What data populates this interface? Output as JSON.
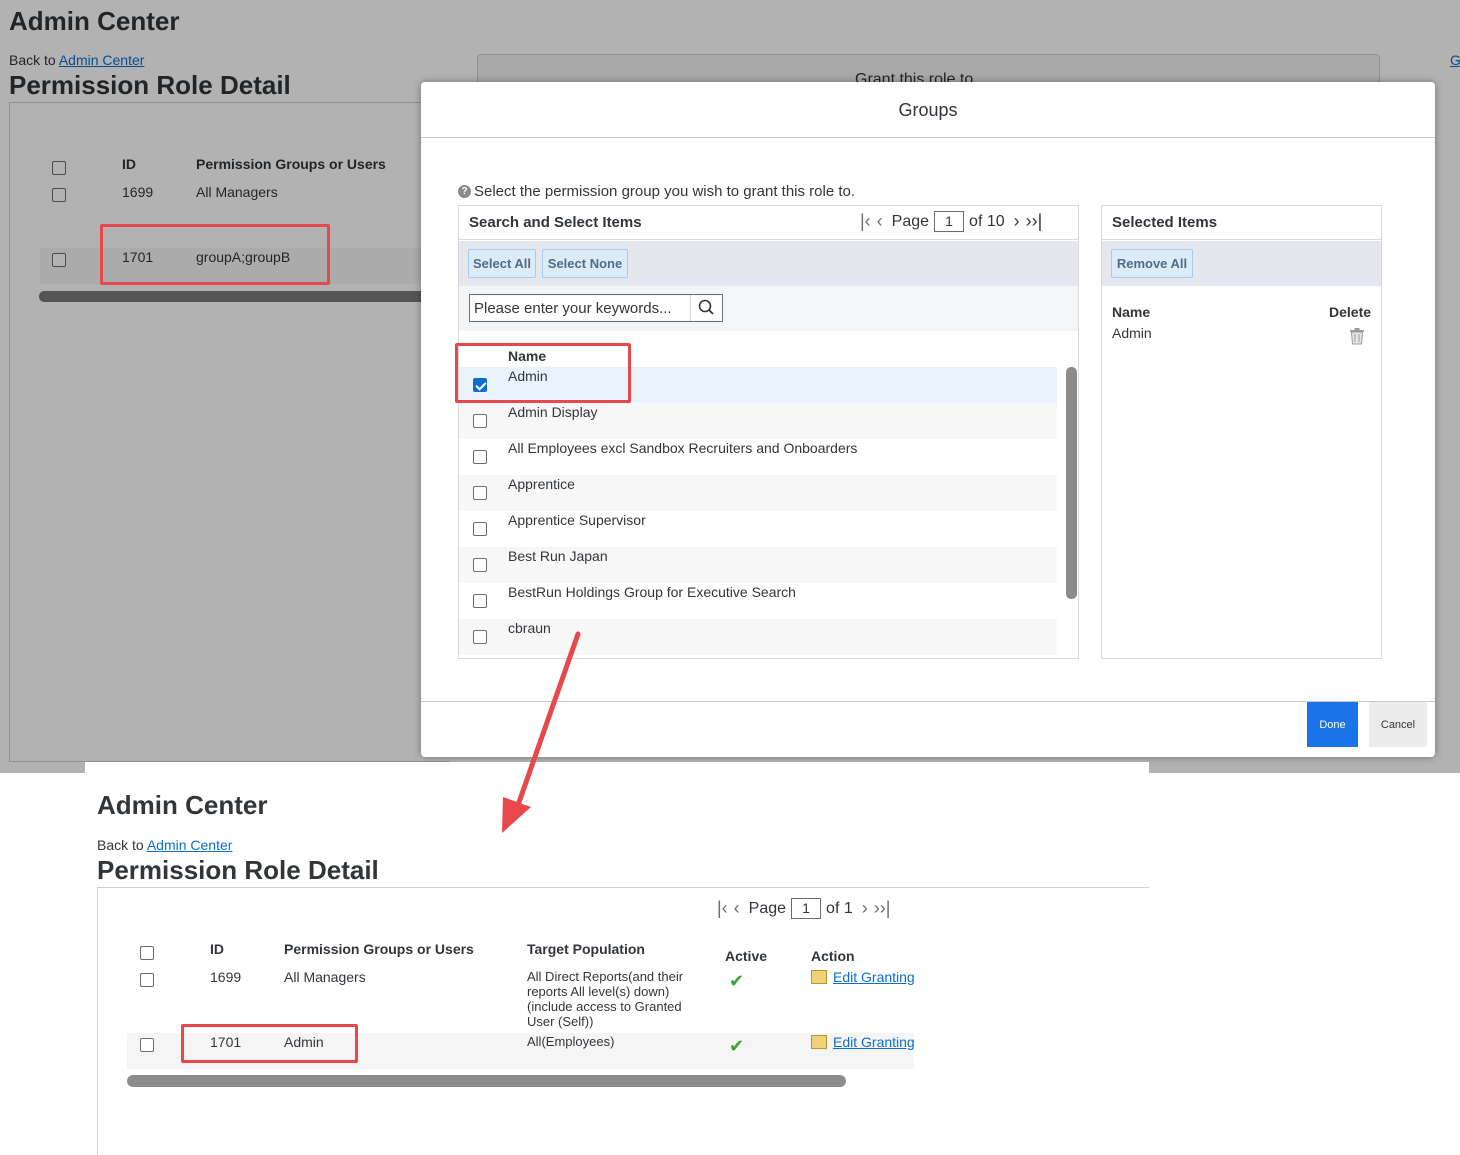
{
  "top": {
    "app_title": "Admin Center",
    "back_prefix": "Back to",
    "back_link": "Admin Center",
    "page_title": "Permission Role Detail",
    "grant_header_partial": "Grant this role to",
    "right_edge_link": "G",
    "table": {
      "headers": {
        "id": "ID",
        "groups": "Permission Groups or Users"
      },
      "rows": [
        {
          "id": "1699",
          "groups": "All Managers"
        },
        {
          "id": "1701",
          "groups": "groupA;groupB"
        }
      ]
    }
  },
  "dialog": {
    "title": "Groups",
    "instruction": "Select the permission group you wish to grant this role to.",
    "search_panel": {
      "title": "Search and Select Items",
      "pager": {
        "label": "Page",
        "current": "1",
        "of": "of 10"
      },
      "select_all": "Select All",
      "select_none": "Select None",
      "search_placeholder": "Please enter your keywords...",
      "column_name": "Name",
      "items": [
        {
          "name": "Admin",
          "checked": true
        },
        {
          "name": "Admin Display",
          "checked": false
        },
        {
          "name": "All Employees excl Sandbox Recruiters and Onboarders",
          "checked": false
        },
        {
          "name": "Apprentice",
          "checked": false
        },
        {
          "name": "Apprentice Supervisor",
          "checked": false
        },
        {
          "name": "Best Run Japan",
          "checked": false
        },
        {
          "name": "BestRun Holdings Group for Executive Search",
          "checked": false
        },
        {
          "name": "cbraun",
          "checked": false
        }
      ]
    },
    "selected_panel": {
      "title": "Selected Items",
      "remove_all": "Remove All",
      "col_name": "Name",
      "col_delete": "Delete",
      "items": [
        {
          "name": "Admin"
        }
      ]
    },
    "done": "Done",
    "cancel": "Cancel"
  },
  "bottom": {
    "app_title": "Admin Center",
    "back_prefix": "Back to",
    "back_link": "Admin Center",
    "page_title": "Permission Role Detail",
    "pager": {
      "label": "Page",
      "current": "1",
      "of": "of 1"
    },
    "headers": {
      "id": "ID",
      "groups": "Permission Groups or Users",
      "target": "Target Population",
      "active": "Active",
      "action": "Action"
    },
    "rows": [
      {
        "id": "1699",
        "groups": "All Managers",
        "target": "All Direct Reports(and their reports All level(s) down) (include access to Granted User (Self))",
        "active": "✔",
        "action": "Edit Granting"
      },
      {
        "id": "1701",
        "groups": "Admin",
        "target": "All(Employees)",
        "active": "✔",
        "action": "Edit Granting"
      }
    ]
  },
  "colors": {
    "highlight": "#e8474c",
    "primary_button": "#0a6ed1",
    "check": "#3aa537",
    "link": "#0a6ed1"
  },
  "icons": [
    "help-icon",
    "first-page-icon",
    "prev-page-icon",
    "next-page-icon",
    "last-page-icon",
    "search-icon",
    "trash-icon",
    "pencil-edit-icon",
    "checkmark-icon",
    "arrow-annotation"
  ]
}
